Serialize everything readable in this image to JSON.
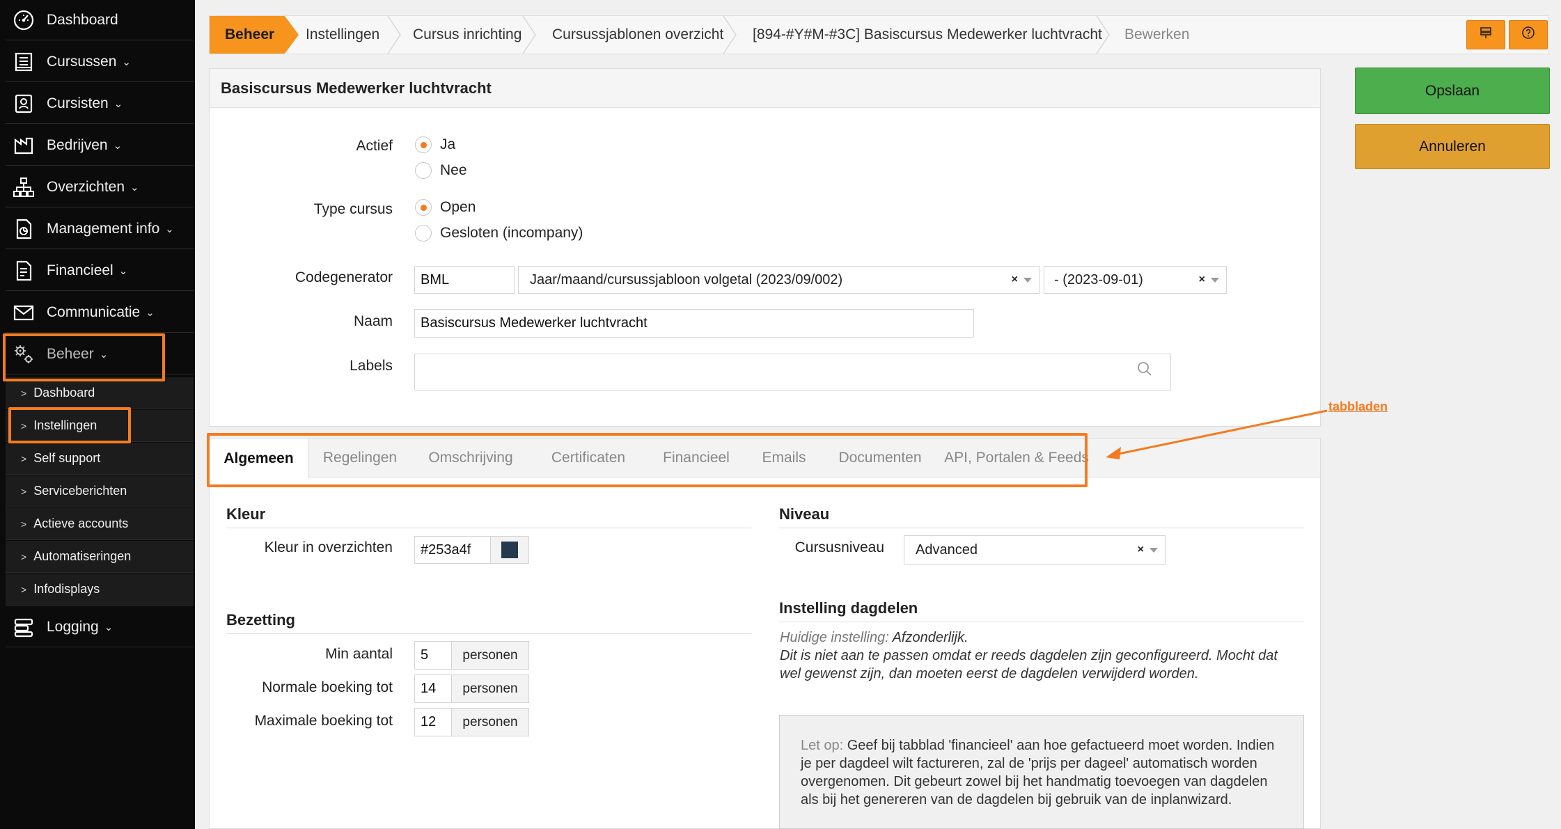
{
  "sidebar": {
    "items": [
      {
        "label": "Dashboard",
        "icon": "dashboard-icon",
        "chevron": ""
      },
      {
        "label": "Cursussen",
        "icon": "book-icon",
        "chevron": "⌄"
      },
      {
        "label": "Cursisten",
        "icon": "contact-icon",
        "chevron": "⌄"
      },
      {
        "label": "Bedrijven",
        "icon": "factory-icon",
        "chevron": "⌄"
      },
      {
        "label": "Overzichten",
        "icon": "sitemap-icon",
        "chevron": "⌄"
      },
      {
        "label": "Management info",
        "icon": "report-icon",
        "chevron": "⌄"
      },
      {
        "label": "Financieel",
        "icon": "invoice-icon",
        "chevron": "⌄"
      },
      {
        "label": "Communicatie",
        "icon": "envelope-icon",
        "chevron": "⌄"
      },
      {
        "label": "Beheer",
        "icon": "gears-icon",
        "chevron": "⌄"
      }
    ],
    "subitems": [
      {
        "label": "Dashboard"
      },
      {
        "label": "Instellingen"
      },
      {
        "label": "Self support"
      },
      {
        "label": "Serviceberichten"
      },
      {
        "label": "Actieve accounts"
      },
      {
        "label": "Automatiseringen"
      },
      {
        "label": "Infodisplays"
      }
    ],
    "logging": {
      "label": "Logging",
      "icon": "server-icon",
      "chevron": "⌄"
    }
  },
  "breadcrumb": {
    "items": [
      "Beheer",
      "Instellingen",
      "Cursus inrichting",
      "Cursussjablonen overzicht",
      "[894-#Y#M-#3C] Basiscursus Medewerker luchtvracht",
      "Bewerken"
    ],
    "buttons": [
      "layout-icon",
      "help-icon"
    ]
  },
  "actions": {
    "save_label": "Opslaan",
    "cancel_label": "Annuleren"
  },
  "form": {
    "title": "Basiscursus Medewerker luchtvracht",
    "actief": {
      "label": "Actief",
      "options": [
        "Ja",
        "Nee"
      ],
      "selected": "Ja"
    },
    "type": {
      "label": "Type cursus",
      "options": [
        "Open",
        "Gesloten (incompany)"
      ],
      "selected": "Open"
    },
    "codegenerator": {
      "label": "Codegenerator",
      "code": "BML",
      "format": "Jaar/maand/cursussjabloon volgetal (2023/09/002)",
      "date": "- (2023-09-01)"
    },
    "naam": {
      "label": "Naam",
      "value": "Basiscursus Medewerker luchtvracht"
    },
    "labels": {
      "label": "Labels",
      "value": ""
    }
  },
  "tabs": {
    "items": [
      "Algemeen",
      "Regelingen",
      "Omschrijving",
      "Certificaten",
      "Financieel",
      "Emails",
      "Documenten",
      "API, Portalen & Feeds"
    ],
    "active": "Algemeen"
  },
  "annotation": {
    "label": "tabbladen",
    "color": "#f47b20"
  },
  "algemeen": {
    "kleur": {
      "section": "Kleur",
      "label": "Kleur in overzichten",
      "value": "#253a4f",
      "swatch": "#253a4f"
    },
    "bezetting": {
      "section": "Bezetting",
      "rows": [
        {
          "label": "Min aantal",
          "value": "5",
          "unit": "personen"
        },
        {
          "label": "Normale boeking tot",
          "value": "14",
          "unit": "personen"
        },
        {
          "label": "Maximale boeking tot",
          "value": "12",
          "unit": "personen"
        }
      ]
    },
    "niveau": {
      "section": "Niveau",
      "label": "Cursusniveau",
      "value": "Advanced"
    },
    "dagdelen": {
      "section": "Instelling dagdelen",
      "current_label": "Huidige instelling:",
      "current_value": " Afzonderlijk.",
      "line2": "Dit is niet aan te passen omdat er reeds dagdelen zijn geconfigureerd. Mocht dat wel gewenst zijn, dan moeten eerst de dagdelen verwijderd worden."
    },
    "letop": {
      "label": "Let op:",
      "text": " Geef bij tabblad 'financieel' aan hoe gefactueerd moet worden. Indien je per dagdeel wilt factureren, zal de 'prijs per dageel' automatisch worden overgenomen. Dit gebeurt zowel bij het handmatig toevoegen van dagdelen als bij het genereren van de dagdelen bij gebruik van de inplanwizard."
    }
  }
}
